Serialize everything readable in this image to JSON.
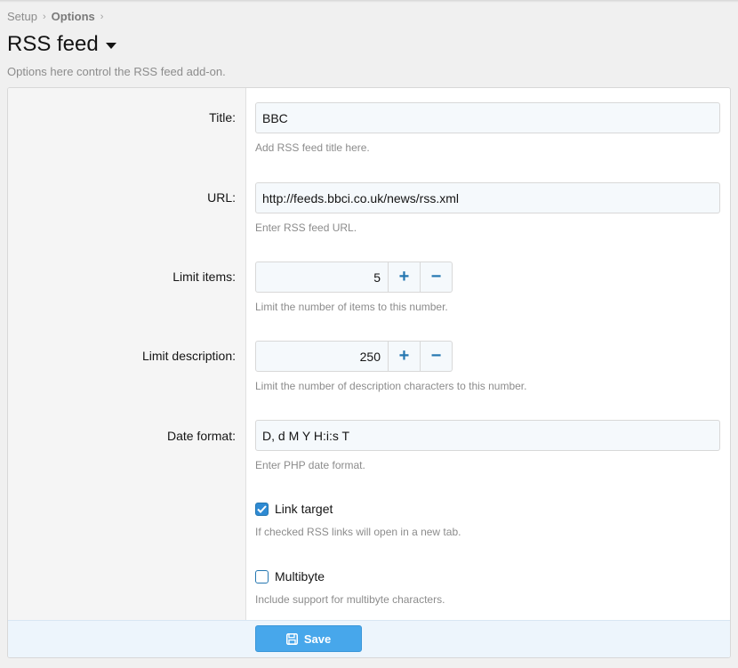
{
  "breadcrumb": {
    "items": [
      "Setup",
      "Options"
    ]
  },
  "page": {
    "title": "RSS feed",
    "description": "Options here control the RSS feed add-on."
  },
  "options": {
    "title": {
      "label": "Title:",
      "value": "BBC",
      "hint": "Add RSS feed title here."
    },
    "url": {
      "label": "URL:",
      "value": "http://feeds.bbci.co.uk/news/rss.xml",
      "hint": "Enter RSS feed URL."
    },
    "limit_items": {
      "label": "Limit items:",
      "value": "5",
      "hint": "Limit the number of items to this number."
    },
    "limit_description": {
      "label": "Limit description:",
      "value": "250",
      "hint": "Limit the number of description characters to this number."
    },
    "date_format": {
      "label": "Date format:",
      "value": "D, d M Y H:i:s T",
      "hint": "Enter PHP date format."
    },
    "link_target": {
      "label": "Link target",
      "checked": true,
      "hint": "If checked RSS links will open in a new tab."
    },
    "multibyte": {
      "label": "Multibyte",
      "checked": false,
      "hint": "Include support for multibyte characters."
    }
  },
  "stepper": {
    "plus": "+",
    "minus": "−"
  },
  "footer": {
    "save_label": "Save"
  },
  "colors": {
    "accent": "#47a7eb",
    "link": "#2577b1"
  }
}
